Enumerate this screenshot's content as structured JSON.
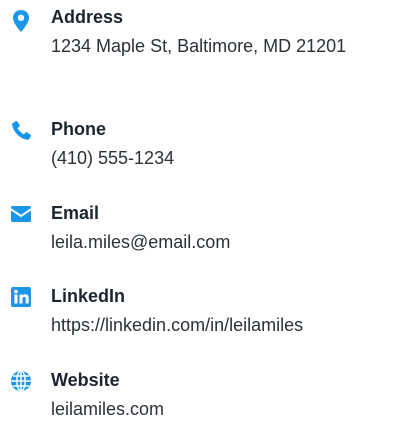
{
  "accent_color": "#1a96e8",
  "contacts": [
    {
      "icon": "map-pin-icon",
      "label": "Address",
      "value": "1234 Maple St, Baltimore, MD 21201"
    },
    {
      "icon": "phone-icon",
      "label": "Phone",
      "value": "(410) 555-1234"
    },
    {
      "icon": "envelope-icon",
      "label": "Email",
      "value": "leila.miles@email.com"
    },
    {
      "icon": "linkedin-icon",
      "label": "LinkedIn",
      "value": "https://linkedin.com/in/leilamiles"
    },
    {
      "icon": "globe-icon",
      "label": "Website",
      "value": "leilamiles.com"
    }
  ]
}
